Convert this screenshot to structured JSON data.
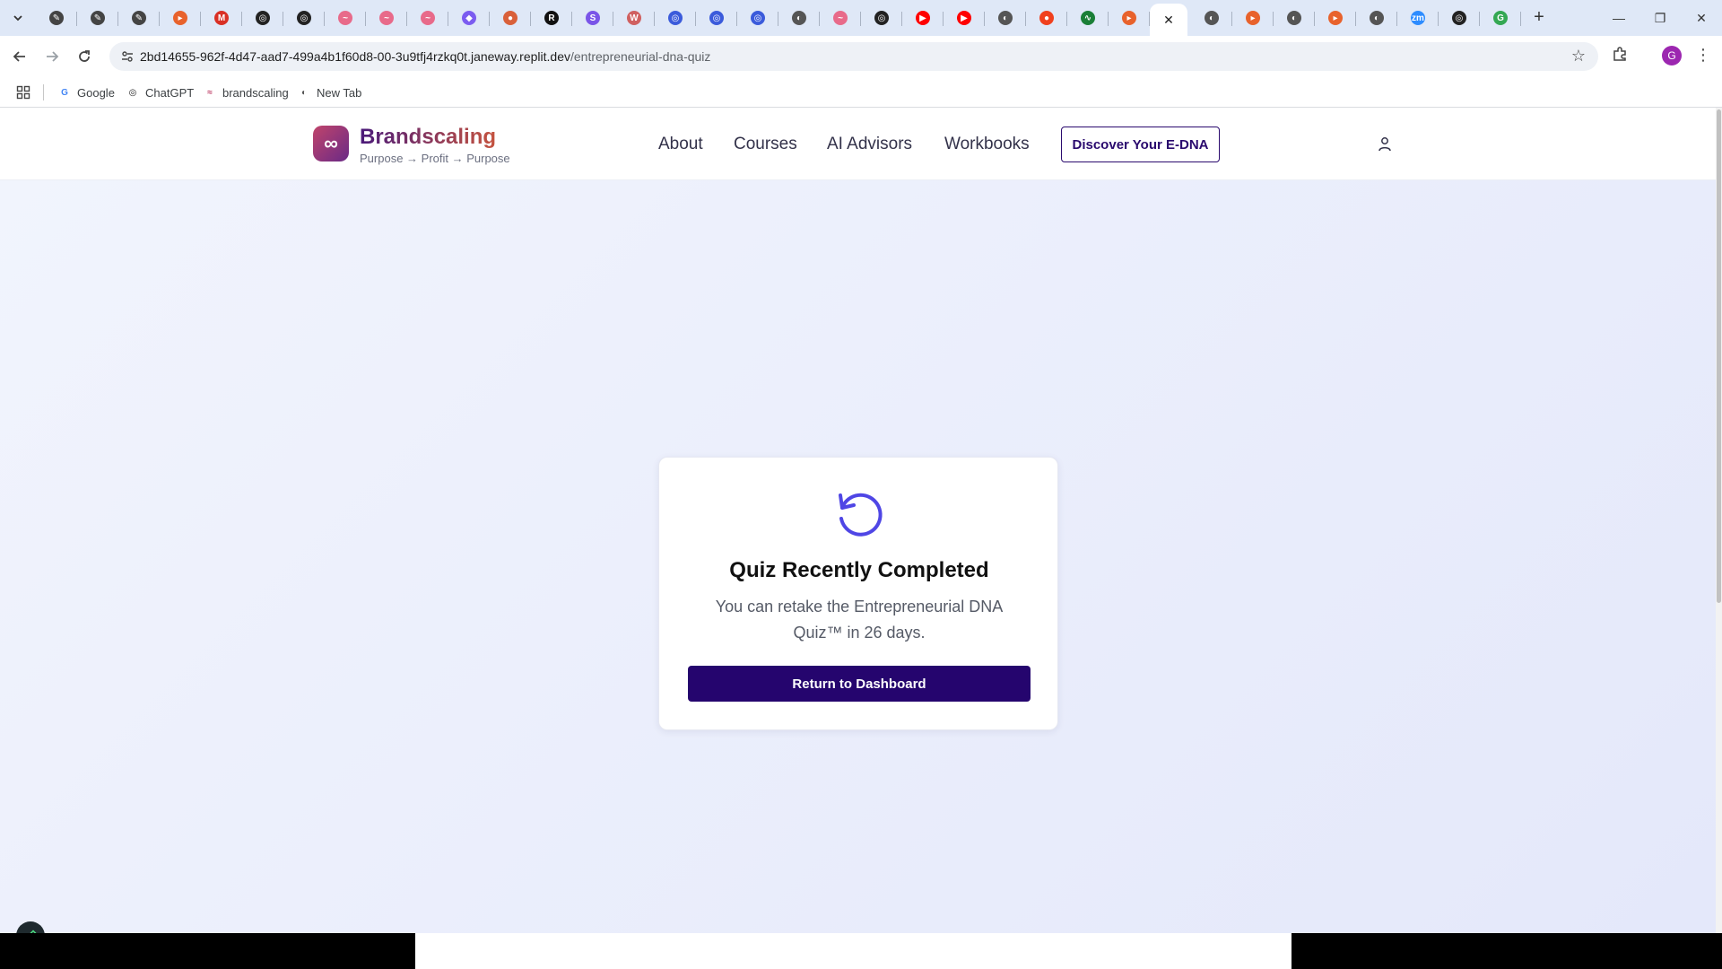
{
  "browser": {
    "tabs": [
      {
        "icon": "link-icon",
        "color": "#444444",
        "glyph": "✎"
      },
      {
        "icon": "link-icon",
        "color": "#444444",
        "glyph": "✎"
      },
      {
        "icon": "link-icon",
        "color": "#444444",
        "glyph": "✎"
      },
      {
        "icon": "brand-icon",
        "color": "#e8622c",
        "glyph": "▸"
      },
      {
        "icon": "gmail-icon",
        "color": "#d93025",
        "glyph": "M"
      },
      {
        "icon": "chatgpt-icon",
        "color": "#222222",
        "glyph": "◎"
      },
      {
        "icon": "chatgpt-icon",
        "color": "#222222",
        "glyph": "◎"
      },
      {
        "icon": "flow-icon",
        "color": "#e86a8a",
        "glyph": "~"
      },
      {
        "icon": "flow-icon",
        "color": "#e86a8a",
        "glyph": "~"
      },
      {
        "icon": "flow-icon",
        "color": "#e86a8a",
        "glyph": "~"
      },
      {
        "icon": "app-icon",
        "color": "#7b5cf0",
        "glyph": "◆"
      },
      {
        "icon": "claude-icon",
        "color": "#d9603a",
        "glyph": "●"
      },
      {
        "icon": "r-icon",
        "color": "#111111",
        "glyph": "R"
      },
      {
        "icon": "s-icon",
        "color": "#7a55e8",
        "glyph": "S"
      },
      {
        "icon": "wp-icon",
        "color": "#d06060",
        "glyph": "W"
      },
      {
        "icon": "target-icon",
        "color": "#3b5bdb",
        "glyph": "◎"
      },
      {
        "icon": "target-icon",
        "color": "#3b5bdb",
        "glyph": "◎"
      },
      {
        "icon": "target-icon",
        "color": "#3b5bdb",
        "glyph": "◎"
      },
      {
        "icon": "globe-icon",
        "color": "#555555",
        "glyph": "◐"
      },
      {
        "icon": "flow-icon",
        "color": "#e86a8a",
        "glyph": "~"
      },
      {
        "icon": "chatgpt-icon",
        "color": "#222222",
        "glyph": "◎"
      },
      {
        "icon": "youtube-icon",
        "color": "#ff0000",
        "glyph": "▶"
      },
      {
        "icon": "youtube-icon",
        "color": "#ff0000",
        "glyph": "▶"
      },
      {
        "icon": "globe-icon",
        "color": "#555555",
        "glyph": "◐"
      },
      {
        "icon": "record-icon",
        "color": "#f0401e",
        "glyph": "●"
      },
      {
        "icon": "pulse-icon",
        "color": "#1a7f37",
        "glyph": "∿"
      },
      {
        "icon": "brand-icon",
        "color": "#e8622c",
        "glyph": "▸"
      },
      {
        "icon": "globe-icon",
        "color": "#555555",
        "glyph": "◐"
      },
      {
        "icon": "brand-icon",
        "color": "#e8622c",
        "glyph": "▸"
      },
      {
        "icon": "globe-icon",
        "color": "#555555",
        "glyph": "◐"
      },
      {
        "icon": "brand-icon",
        "color": "#e8622c",
        "glyph": "▸"
      },
      {
        "icon": "globe-icon",
        "color": "#555555",
        "glyph": "◐"
      },
      {
        "icon": "zoom-icon",
        "color": "#2d8cff",
        "glyph": "zm"
      },
      {
        "icon": "chatgpt-icon",
        "color": "#222222",
        "glyph": "◎"
      },
      {
        "icon": "google-icon",
        "color": "#34a853",
        "glyph": "G"
      }
    ],
    "active_tab_close": "✕",
    "new_tab": "+",
    "window_controls": {
      "minimize": "—",
      "restore": "❐",
      "close": "✕"
    },
    "url_host": "2bd14655-962f-4d47-aad7-499a4b1f60d8-00-3u9tfj4rzkq0t.janeway.replit.dev",
    "url_path": "/entrepreneurial-dna-quiz",
    "profile_initial": "G",
    "bookmarks": [
      {
        "label": "Google",
        "icon": "google-icon",
        "glyph": "G",
        "color": "#4285f4"
      },
      {
        "label": "ChatGPT",
        "icon": "chatgpt-icon",
        "glyph": "◎",
        "color": "#222222"
      },
      {
        "label": "brandscaling",
        "icon": "brandscaling-icon",
        "glyph": "≈",
        "color": "#c0446b"
      },
      {
        "label": "New Tab",
        "icon": "globe-icon",
        "glyph": "◐",
        "color": "#555555"
      }
    ]
  },
  "site": {
    "brand_name": "Brandscaling",
    "tagline": "Purpose → Profit → Purpose",
    "logo_glyph": "∞",
    "nav": [
      "About",
      "Courses",
      "AI Advisors",
      "Workbooks"
    ],
    "cta_label": "Discover Your E-DNA",
    "colors": {
      "primary": "#25056e",
      "accent": "#4f46e5"
    }
  },
  "card": {
    "icon": "retake-icon",
    "title": "Quiz Recently Completed",
    "message": "You can retake the Entrepreneurial DNA Quiz™ in 26 days.",
    "button_label": "Return to Dashboard"
  }
}
